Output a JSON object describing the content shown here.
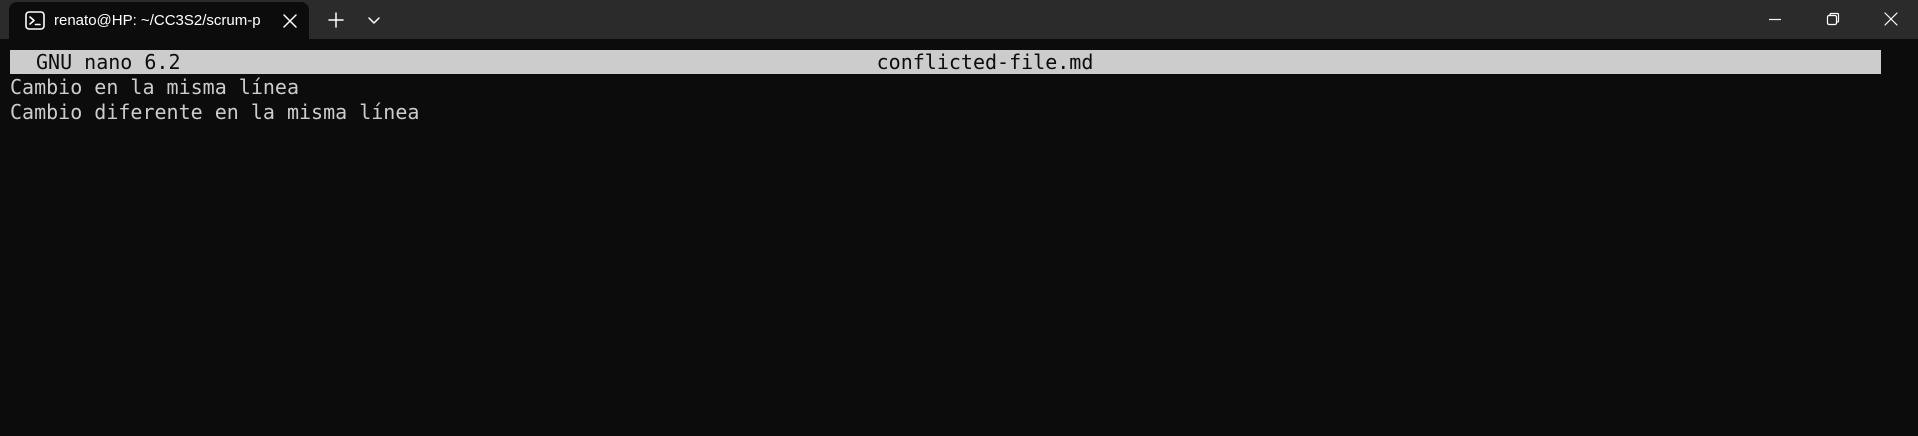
{
  "window": {
    "tab_title": "renato@HP: ~/CC3S2/scrum-p",
    "tab_icon": "terminal-icon",
    "new_tab_icon": "plus-icon",
    "dropdown_icon": "chevron-down-icon",
    "controls": [
      "minimize-icon",
      "restore-icon",
      "close-icon"
    ]
  },
  "nano": {
    "version": "GNU nano 6.2",
    "filename": "conflicted-file.md",
    "lines": [
      "Cambio en la misma línea",
      "Cambio diferente en la misma línea"
    ]
  },
  "colors": {
    "titlebar_bg": "#2b2b2b",
    "terminal_bg": "#0c0c0c",
    "header_bar_bg": "#cccccc",
    "text": "#cccccc"
  }
}
